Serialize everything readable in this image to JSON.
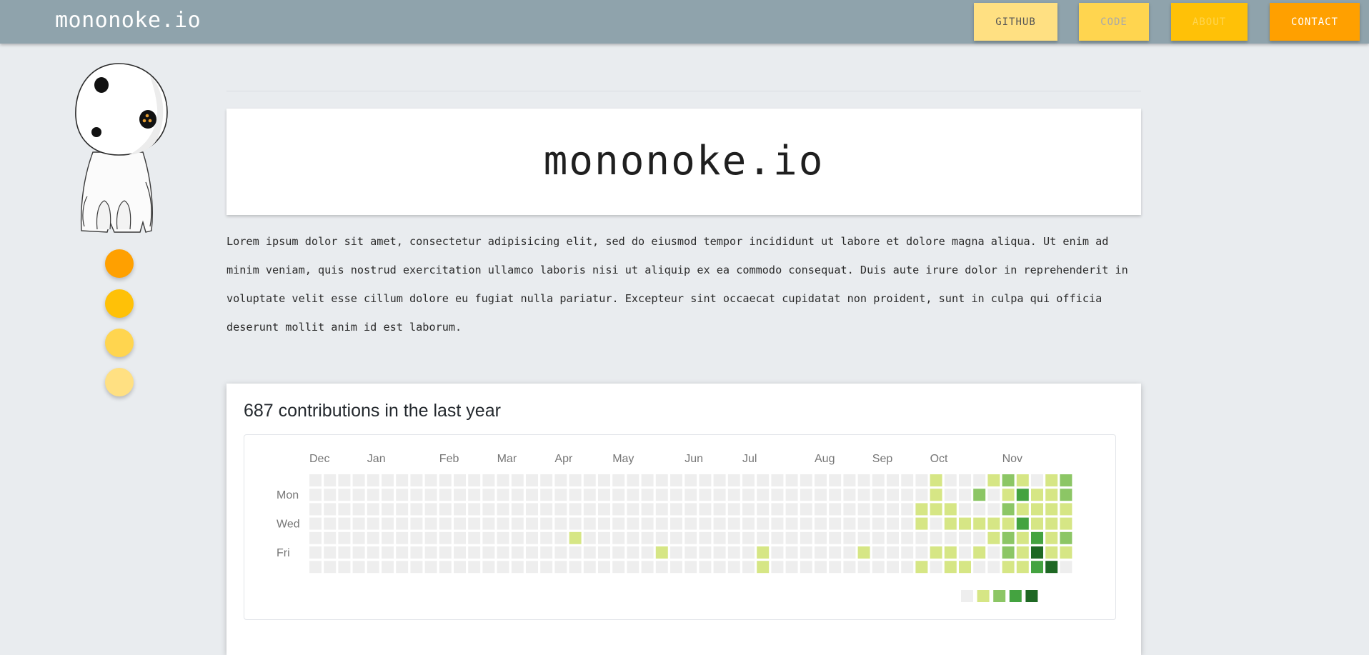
{
  "header": {
    "brand": "mononoke.io",
    "nav": [
      {
        "label": "GITHUB",
        "bg": "#ffe082",
        "color": "#555555"
      },
      {
        "label": "CODE",
        "bg": "#ffd54f",
        "color": "#a9a9a9"
      },
      {
        "label": "ABOUT",
        "bg": "#ffc107",
        "color": "#ffd54f"
      },
      {
        "label": "CONTACT",
        "bg": "#ffa000",
        "color": "#ffffff"
      }
    ]
  },
  "sidebar": {
    "dots": [
      {
        "color": "#ffa000"
      },
      {
        "color": "#ffc107"
      },
      {
        "color": "#ffd54f"
      },
      {
        "color": "#ffe082"
      }
    ]
  },
  "hero": {
    "title": "mononoke.io"
  },
  "intro": {
    "text": "Lorem ipsum dolor sit amet, consectetur adipisicing elit, sed do eiusmod tempor incididunt ut labore et dolore magna aliqua. Ut enim ad minim veniam, quis nostrud exercitation ullamco laboris nisi ut aliquip ex ea commodo consequat. Duis aute irure dolor in reprehenderit in voluptate velit esse cillum dolore eu fugiat nulla pariatur. Excepteur sint occaecat cupidatat non proident, sunt in culpa qui officia deserunt mollit anim id est laborum."
  },
  "contributions": {
    "title": "687 contributions in the last year",
    "months": [
      {
        "label": "Dec",
        "week": 0
      },
      {
        "label": "Jan",
        "week": 4
      },
      {
        "label": "Feb",
        "week": 9
      },
      {
        "label": "Mar",
        "week": 13
      },
      {
        "label": "Apr",
        "week": 17
      },
      {
        "label": "May",
        "week": 21
      },
      {
        "label": "Jun",
        "week": 26
      },
      {
        "label": "Jul",
        "week": 30
      },
      {
        "label": "Aug",
        "week": 35
      },
      {
        "label": "Sep",
        "week": 39
      },
      {
        "label": "Oct",
        "week": 43
      },
      {
        "label": "Nov",
        "week": 48
      }
    ],
    "day_labels": [
      {
        "label": "Mon",
        "row": 1
      },
      {
        "label": "Wed",
        "row": 3
      },
      {
        "label": "Fri",
        "row": 5
      }
    ],
    "level_colors": [
      "#eeeeee",
      "#d6e685",
      "#8cc665",
      "#44a340",
      "#1e6823"
    ],
    "weeks": 53,
    "active": [
      [
        18,
        4,
        1
      ],
      [
        24,
        5,
        1
      ],
      [
        31,
        5,
        1
      ],
      [
        31,
        6,
        1
      ],
      [
        38,
        5,
        1
      ],
      [
        42,
        2,
        1
      ],
      [
        42,
        3,
        1
      ],
      [
        42,
        6,
        1
      ],
      [
        43,
        0,
        1
      ],
      [
        43,
        1,
        1
      ],
      [
        43,
        2,
        1
      ],
      [
        43,
        5,
        1
      ],
      [
        44,
        2,
        1
      ],
      [
        44,
        3,
        1
      ],
      [
        44,
        5,
        1
      ],
      [
        44,
        6,
        1
      ],
      [
        45,
        3,
        1
      ],
      [
        45,
        6,
        1
      ],
      [
        46,
        1,
        2
      ],
      [
        46,
        3,
        1
      ],
      [
        46,
        5,
        1
      ],
      [
        47,
        0,
        1
      ],
      [
        47,
        3,
        1
      ],
      [
        47,
        4,
        1
      ],
      [
        48,
        0,
        2
      ],
      [
        48,
        1,
        1
      ],
      [
        48,
        2,
        2
      ],
      [
        48,
        3,
        1
      ],
      [
        48,
        4,
        2
      ],
      [
        48,
        5,
        2
      ],
      [
        48,
        6,
        1
      ],
      [
        49,
        0,
        1
      ],
      [
        49,
        1,
        3
      ],
      [
        49,
        2,
        1
      ],
      [
        49,
        3,
        3
      ],
      [
        49,
        4,
        1
      ],
      [
        49,
        5,
        1
      ],
      [
        49,
        6,
        1
      ],
      [
        50,
        1,
        1
      ],
      [
        50,
        2,
        1
      ],
      [
        50,
        3,
        1
      ],
      [
        50,
        4,
        3
      ],
      [
        50,
        5,
        4
      ],
      [
        50,
        6,
        3
      ],
      [
        51,
        0,
        1
      ],
      [
        51,
        1,
        1
      ],
      [
        51,
        2,
        1
      ],
      [
        51,
        3,
        1
      ],
      [
        51,
        4,
        1
      ],
      [
        51,
        5,
        1
      ],
      [
        51,
        6,
        4
      ],
      [
        52,
        0,
        2
      ],
      [
        52,
        1,
        2
      ],
      [
        52,
        2,
        1
      ],
      [
        52,
        3,
        1
      ],
      [
        52,
        4,
        2
      ],
      [
        52,
        5,
        1
      ]
    ]
  }
}
